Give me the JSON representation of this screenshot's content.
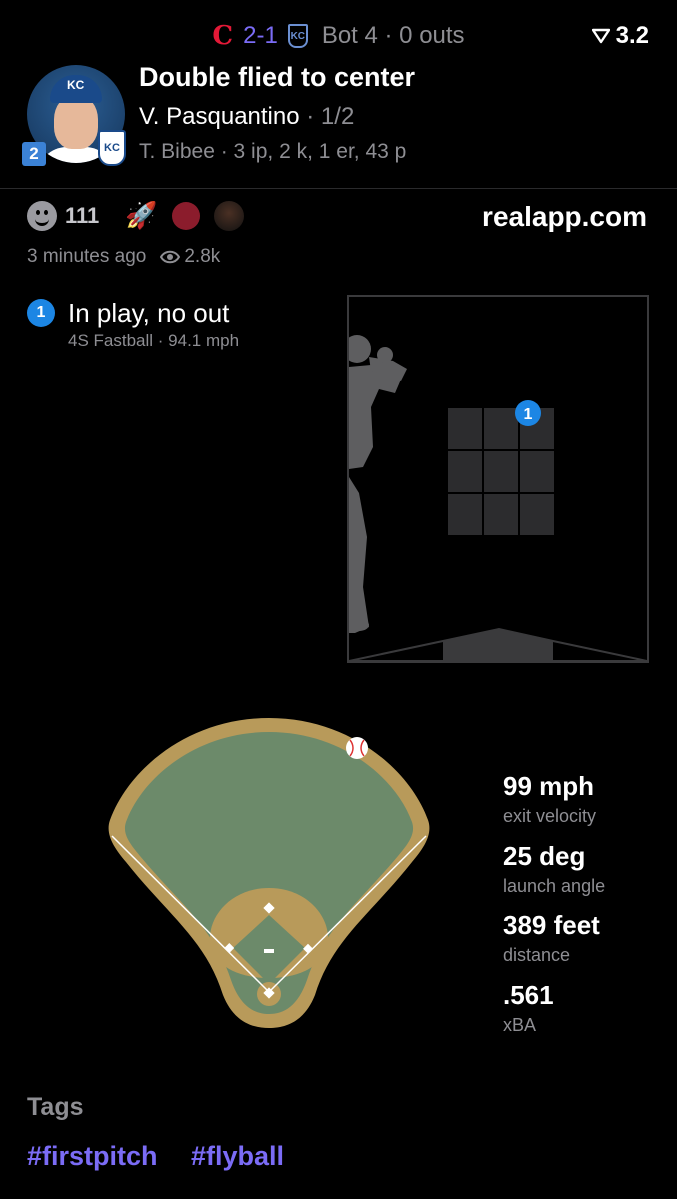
{
  "header": {
    "away_logo": "C",
    "score": "2-1",
    "home_logo": "KC",
    "inning": "Bot 4 · 0 outs",
    "rating": "3.2",
    "rating_icon": "filter-v-icon"
  },
  "play": {
    "title": "Double flied to center",
    "batter": "V. Pasquantino",
    "batter_count": "· 1/2",
    "pitcher_line": "T. Bibee · 3 ip, 2 k, 1 er, 43 p",
    "jersey_number": "2",
    "cap_logo": "KC",
    "team_badge": "KC"
  },
  "reactions": {
    "count": "111",
    "time": "3 minutes ago",
    "views": "2.8k",
    "brand": "realapp.com"
  },
  "pitch": {
    "number": "1",
    "result": "In play, no out",
    "pitch_type": "4S Fastball",
    "speed": "94.1 mph",
    "zone_marker": "1"
  },
  "stats": [
    {
      "value": "99 mph",
      "label": "exit velocity"
    },
    {
      "value": "25 deg",
      "label": "launch angle"
    },
    {
      "value": "389 feet",
      "label": "distance"
    },
    {
      "value": ".561",
      "label": "xBA"
    }
  ],
  "tags": {
    "heading": "Tags",
    "items": [
      "#firstpitch",
      "#flyball"
    ]
  },
  "colors": {
    "accent": "#7b6cf6",
    "pitch_blue": "#1c86e4",
    "dirt": "#b89a5a",
    "grass": "#6c8a6a"
  }
}
